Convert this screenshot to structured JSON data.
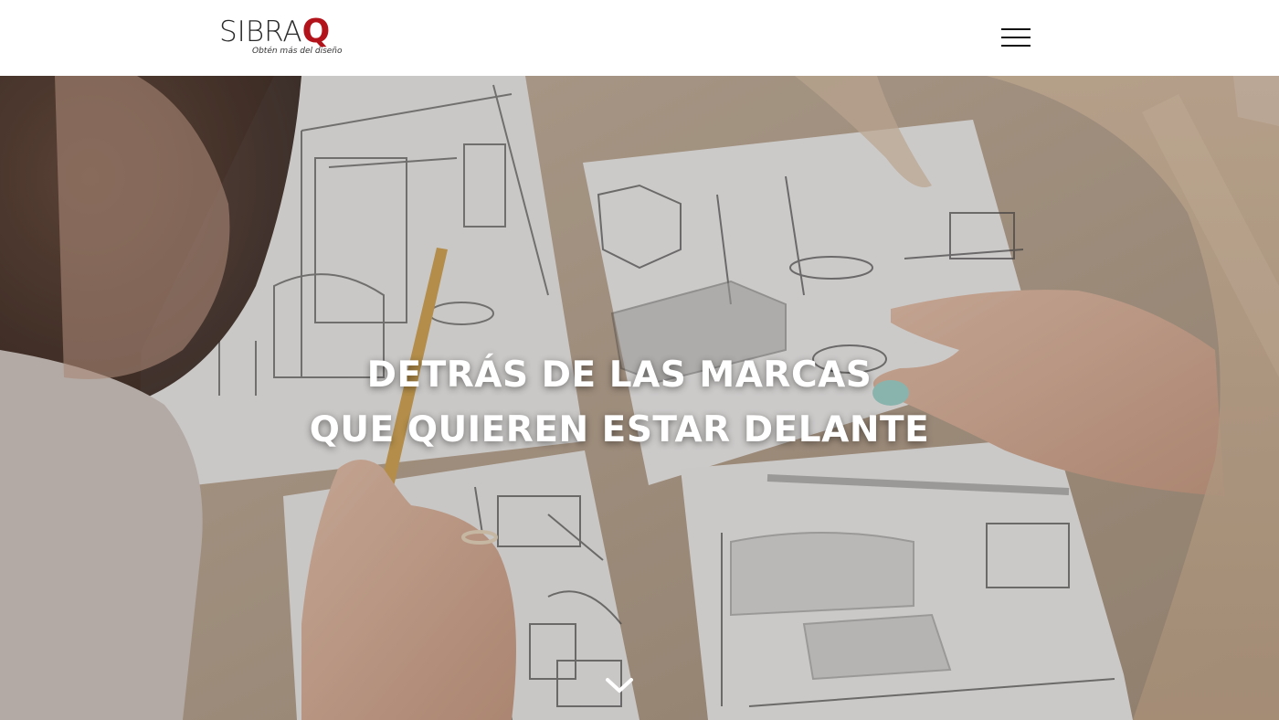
{
  "header": {
    "logo": {
      "wordmark_main": "SIBRA",
      "wordmark_accent": "Q",
      "tagline": "Obtén más del diseño",
      "accent_color": "#b3131b"
    },
    "menu_icon": "hamburger-menu-icon"
  },
  "hero": {
    "headline_line1": "DETRÁS DE LAS MARCAS",
    "headline_line2": "QUE QUIEREN ESTAR DELANTE",
    "scroll_icon": "chevron-down-icon",
    "background_description_icon": "hero-background-image"
  }
}
